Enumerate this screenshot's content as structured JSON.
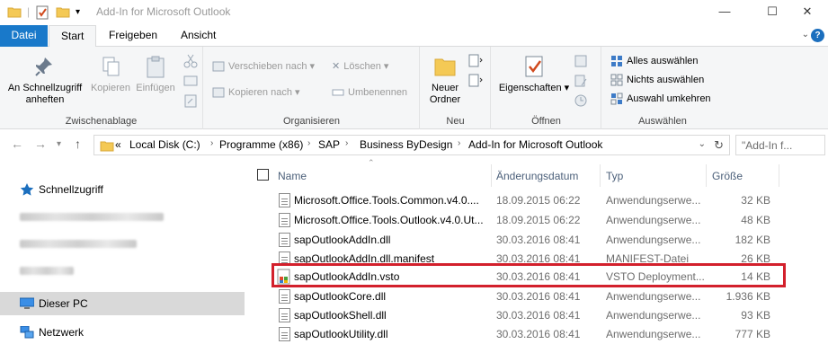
{
  "window": {
    "title": "Add-In for Microsoft Outlook",
    "minimize": "—",
    "maximize": "☐",
    "close": "✕"
  },
  "ribbon_tabs": [
    "Datei",
    "Start",
    "Freigeben",
    "Ansicht"
  ],
  "help": "?",
  "ribbon": {
    "zwischenablage": {
      "label": "Zwischenablage",
      "pin": "An Schnellzugriff anheften",
      "copy": "Kopieren",
      "paste": "Einfügen"
    },
    "organisieren": {
      "label": "Organisieren",
      "move_to": "Verschieben nach",
      "copy_to": "Kopieren nach",
      "delete": "Löschen",
      "rename": "Umbenennen"
    },
    "neu": {
      "label": "Neu",
      "new_folder": "Neuer Ordner"
    },
    "oeffnen": {
      "label": "Öffnen",
      "properties": "Eigenschaften"
    },
    "auswaehlen": {
      "label": "Auswählen",
      "select_all": "Alles auswählen",
      "select_none": "Nichts auswählen",
      "invert": "Auswahl umkehren"
    }
  },
  "address": {
    "overflow": "«",
    "crumbs": [
      "Local Disk (C:)",
      "Programme (x86)",
      "SAP",
      "Business ByDesign",
      "Add-In for Microsoft Outlook"
    ],
    "search_placeholder": "\"Add-In f..."
  },
  "navpane": {
    "quick_access": "Schnellzugriff",
    "this_pc": "Dieser PC",
    "network": "Netzwerk"
  },
  "columns": {
    "name": "Name",
    "date": "Änderungsdatum",
    "type": "Typ",
    "size": "Größe"
  },
  "files": [
    {
      "name": "Microsoft.Office.Tools.Common.v4.0....",
      "date": "18.09.2015 06:22",
      "type": "Anwendungserwe...",
      "size": "32 KB"
    },
    {
      "name": "Microsoft.Office.Tools.Outlook.v4.0.Ut...",
      "date": "18.09.2015 06:22",
      "type": "Anwendungserwe...",
      "size": "48 KB"
    },
    {
      "name": "sapOutlookAddIn.dll",
      "date": "30.03.2016 08:41",
      "type": "Anwendungserwe...",
      "size": "182 KB"
    },
    {
      "name": "sapOutlookAddIn.dll.manifest",
      "date": "30.03.2016 08:41",
      "type": "MANIFEST-Datei",
      "size": "26 KB"
    },
    {
      "name": "sapOutlookAddIn.vsto",
      "date": "30.03.2016 08:41",
      "type": "VSTO Deployment...",
      "size": "14 KB"
    },
    {
      "name": "sapOutlookCore.dll",
      "date": "30.03.2016 08:41",
      "type": "Anwendungserwe...",
      "size": "1.936 KB"
    },
    {
      "name": "sapOutlookShell.dll",
      "date": "30.03.2016 08:41",
      "type": "Anwendungserwe...",
      "size": "93 KB"
    },
    {
      "name": "sapOutlookUtility.dll",
      "date": "30.03.2016 08:41",
      "type": "Anwendungserwe...",
      "size": "777 KB"
    }
  ],
  "colors": {
    "file_tab": "#1979ca",
    "highlight": "#d3202c",
    "selected_nav": "#d9d9d9",
    "folder": "#f4c955"
  }
}
